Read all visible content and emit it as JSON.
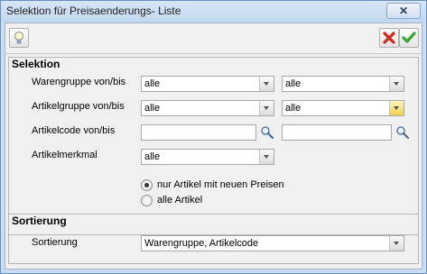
{
  "window": {
    "title": "Selektion für Preisaenderungs- Liste"
  },
  "selektion": {
    "title": "Selektion",
    "warengruppe": {
      "label": "Warengruppe von/bis",
      "from": "alle",
      "to": "alle"
    },
    "artikelgruppe": {
      "label": "Artikelgruppe von/bis",
      "from": "alle",
      "to": "alle"
    },
    "artikelcode": {
      "label": "Artikelcode von/bis",
      "from": "",
      "to": ""
    },
    "artikelmerkmal": {
      "label": "Artikelmerkmal",
      "value": "alle"
    },
    "radios": [
      {
        "label": "nur Artikel mit neuen Preisen",
        "checked": true
      },
      {
        "label": "alle Artikel",
        "checked": false
      }
    ]
  },
  "sortierung": {
    "title": "Sortierung",
    "label": "Sortierung",
    "value": "Warengruppe, Artikelcode"
  },
  "colors": {
    "accent_yellow": "#f2cf4a",
    "cancel_red": "#d9261c",
    "ok_green": "#3aa52f"
  }
}
